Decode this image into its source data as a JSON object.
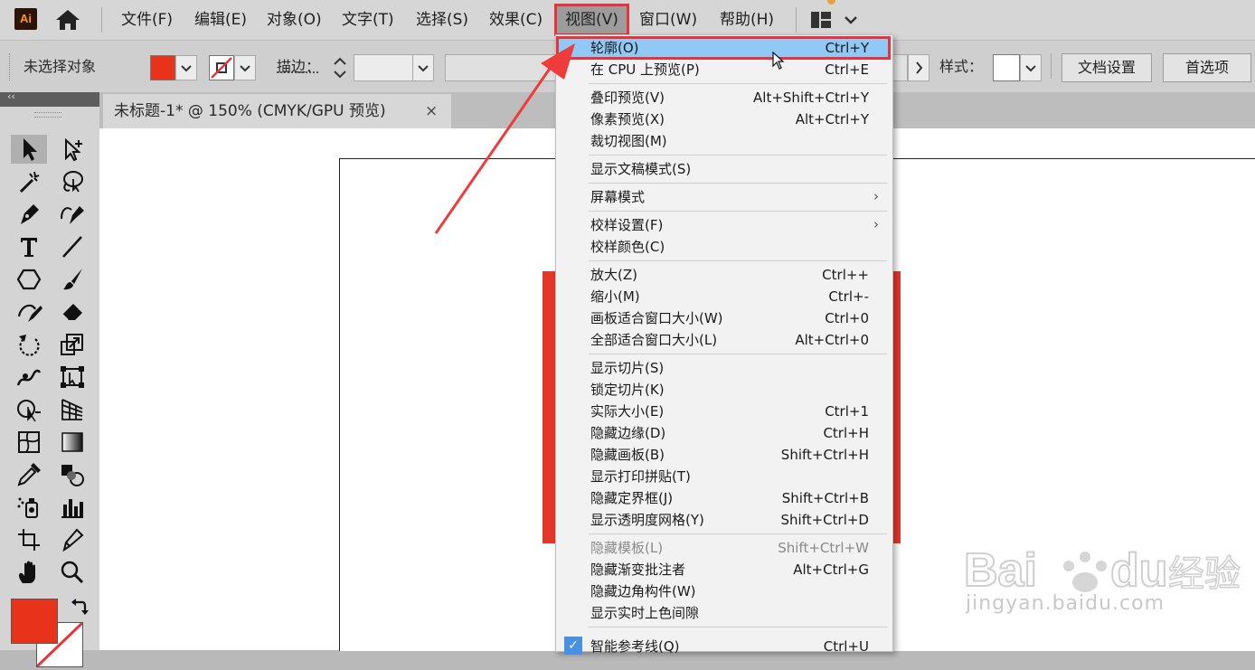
{
  "app": {
    "logo_text": "Ai"
  },
  "menubar": {
    "items": [
      "文件(F)",
      "编辑(E)",
      "对象(O)",
      "文字(T)",
      "选择(S)",
      "效果(C)",
      "视图(V)",
      "窗口(W)",
      "帮助(H)"
    ],
    "active_index": 6
  },
  "control_bar": {
    "selection_status": "未选择对象",
    "stroke_label": "描边：",
    "style_label": "样式：",
    "document_setup_button": "文档设置",
    "preferences_button": "首选项",
    "fill_color": "#e8321a",
    "stroke_color": "none"
  },
  "document": {
    "tab_title": "未标题-1* @ 150% (CMYK/GPU 预览)",
    "close_glyph": "×",
    "rect_color": "#e5362a"
  },
  "view_menu": {
    "items": [
      {
        "label": "轮廓(O)",
        "shortcut": "Ctrl+Y"
      },
      {
        "label": "在 CPU 上预览(P)",
        "shortcut": "Ctrl+E"
      },
      {
        "label": "叠印预览(V)",
        "shortcut": "Alt+Shift+Ctrl+Y"
      },
      {
        "label": "像素预览(X)",
        "shortcut": "Alt+Ctrl+Y"
      },
      {
        "label": "裁切视图(M)",
        "shortcut": ""
      },
      {
        "label": "显示文稿模式(S)",
        "shortcut": ""
      },
      {
        "label": "屏幕模式",
        "shortcut": ""
      },
      {
        "label": "校样设置(F)",
        "shortcut": ""
      },
      {
        "label": "校样颜色(C)",
        "shortcut": ""
      },
      {
        "label": "放大(Z)",
        "shortcut": "Ctrl++"
      },
      {
        "label": "缩小(M)",
        "shortcut": "Ctrl+-"
      },
      {
        "label": "画板适合窗口大小(W)",
        "shortcut": "Ctrl+0"
      },
      {
        "label": "全部适合窗口大小(L)",
        "shortcut": "Alt+Ctrl+0"
      },
      {
        "label": "显示切片(S)",
        "shortcut": ""
      },
      {
        "label": "锁定切片(K)",
        "shortcut": ""
      },
      {
        "label": "实际大小(E)",
        "shortcut": "Ctrl+1"
      },
      {
        "label": "隐藏边缘(D)",
        "shortcut": "Ctrl+H"
      },
      {
        "label": "隐藏画板(B)",
        "shortcut": "Shift+Ctrl+H"
      },
      {
        "label": "显示打印拼贴(T)",
        "shortcut": ""
      },
      {
        "label": "隐藏定界框(J)",
        "shortcut": "Shift+Ctrl+B"
      },
      {
        "label": "显示透明度网格(Y)",
        "shortcut": "Shift+Ctrl+D"
      },
      {
        "label": "隐藏模板(L)",
        "shortcut": "Shift+Ctrl+W"
      },
      {
        "label": "隐藏渐变批注者",
        "shortcut": "Alt+Ctrl+G"
      },
      {
        "label": "隐藏边角构件(W)",
        "shortcut": ""
      },
      {
        "label": "显示实时上色间隙",
        "shortcut": ""
      },
      {
        "label": "智能参考线(Q)",
        "shortcut": "Ctrl+U"
      }
    ]
  },
  "watermark": {
    "text": "jingyan.baidu.com"
  }
}
